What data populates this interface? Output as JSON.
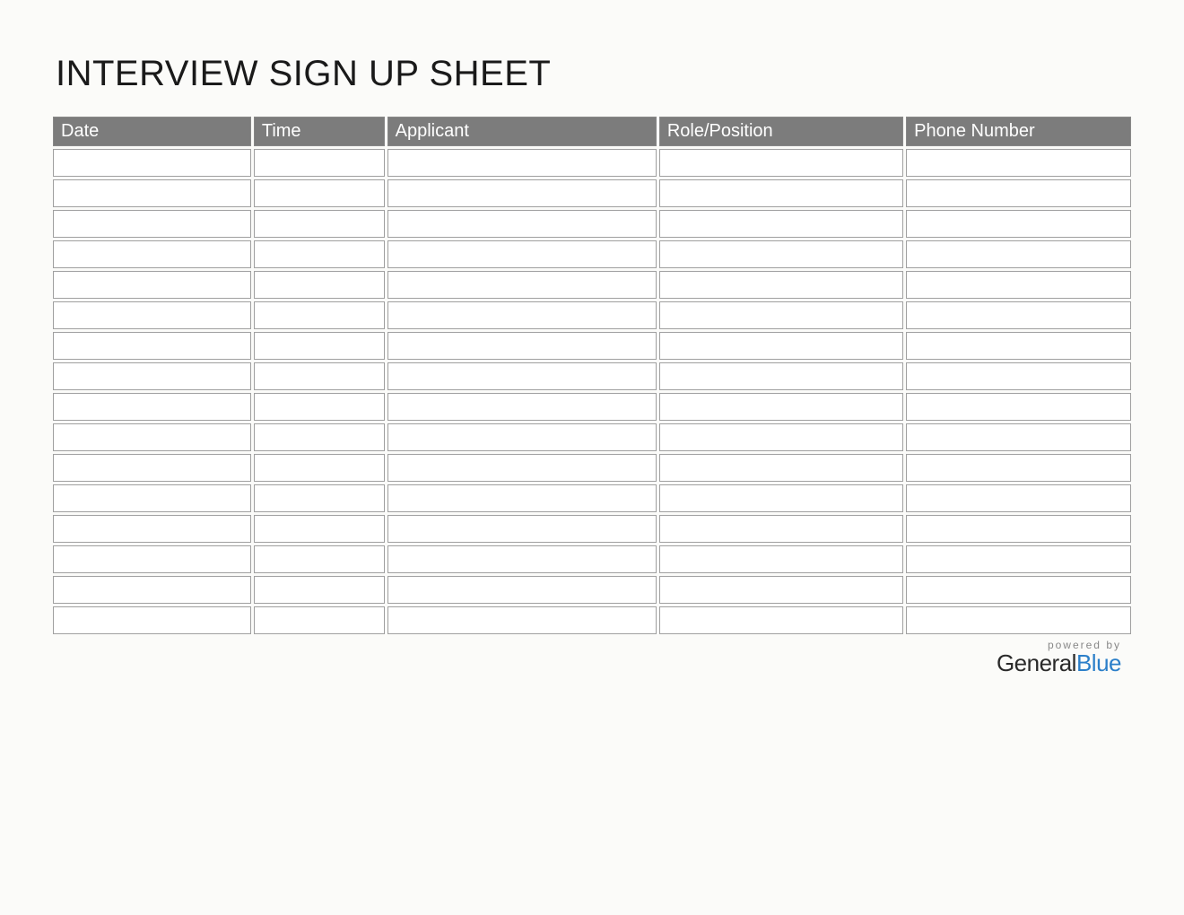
{
  "title": "INTERVIEW SIGN UP SHEET",
  "columns": [
    "Date",
    "Time",
    "Applicant",
    "Role/Position",
    "Phone Number"
  ],
  "rows": [
    [
      "",
      "",
      "",
      "",
      ""
    ],
    [
      "",
      "",
      "",
      "",
      ""
    ],
    [
      "",
      "",
      "",
      "",
      ""
    ],
    [
      "",
      "",
      "",
      "",
      ""
    ],
    [
      "",
      "",
      "",
      "",
      ""
    ],
    [
      "",
      "",
      "",
      "",
      ""
    ],
    [
      "",
      "",
      "",
      "",
      ""
    ],
    [
      "",
      "",
      "",
      "",
      ""
    ],
    [
      "",
      "",
      "",
      "",
      ""
    ],
    [
      "",
      "",
      "",
      "",
      ""
    ],
    [
      "",
      "",
      "",
      "",
      ""
    ],
    [
      "",
      "",
      "",
      "",
      ""
    ],
    [
      "",
      "",
      "",
      "",
      ""
    ],
    [
      "",
      "",
      "",
      "",
      ""
    ],
    [
      "",
      "",
      "",
      "",
      ""
    ],
    [
      "",
      "",
      "",
      "",
      ""
    ]
  ],
  "footer": {
    "powered_by": "powered by",
    "brand_general": "General",
    "brand_blue": "Blue"
  }
}
